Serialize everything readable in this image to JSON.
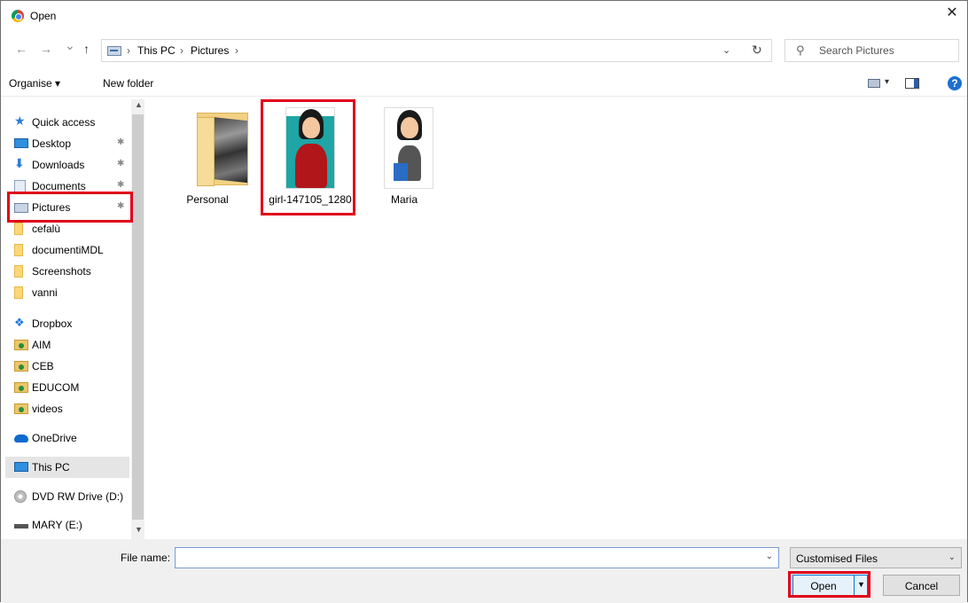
{
  "window": {
    "title": "Open",
    "close_glyph": "✕",
    "app_icon": "chrome-icon"
  },
  "nav": {
    "back_glyph": "←",
    "forward_glyph": "→",
    "recent_glyph": "⌄",
    "up_glyph": "↑",
    "breadcrumbs": [
      "This PC",
      "Pictures"
    ],
    "separator": "›",
    "dropdown_glyph": "⌄",
    "refresh_glyph": "↻",
    "search_placeholder": "Search Pictures",
    "search_glyph": "⚲"
  },
  "toolbar": {
    "organise_label": "Organise ▾",
    "new_folder_label": "New folder",
    "view_caret": "▾",
    "help_glyph": "?"
  },
  "sidebar": {
    "items": [
      {
        "label": "Quick access",
        "icon": "star-icon",
        "pinned": false
      },
      {
        "label": "Desktop",
        "icon": "desktop-icon",
        "pinned": true
      },
      {
        "label": "Downloads",
        "icon": "download-icon",
        "pinned": true
      },
      {
        "label": "Documents",
        "icon": "documents-icon",
        "pinned": true
      },
      {
        "label": "Pictures",
        "icon": "pictures-icon",
        "pinned": true
      },
      {
        "label": "cefalù",
        "icon": "folder-icon",
        "pinned": false
      },
      {
        "label": "documentiMDL",
        "icon": "folder-icon",
        "pinned": false
      },
      {
        "label": "Screenshots",
        "icon": "folder-icon",
        "pinned": false
      },
      {
        "label": "vanni",
        "icon": "folder-icon",
        "pinned": false
      },
      {
        "label": "Dropbox",
        "icon": "dropbox-icon",
        "pinned": false
      },
      {
        "label": "AIM",
        "icon": "shared-folder-icon",
        "pinned": false
      },
      {
        "label": "CEB",
        "icon": "shared-folder-icon",
        "pinned": false
      },
      {
        "label": "EDUCOM",
        "icon": "shared-folder-icon",
        "pinned": false
      },
      {
        "label": "videos",
        "icon": "shared-folder-icon",
        "pinned": false
      },
      {
        "label": "OneDrive",
        "icon": "onedrive-icon",
        "pinned": false
      },
      {
        "label": "This PC",
        "icon": "this-pc-icon",
        "pinned": false
      },
      {
        "label": "DVD RW Drive (D:)",
        "icon": "dvd-drive-icon",
        "pinned": false
      },
      {
        "label": "MARY (E:)",
        "icon": "usb-drive-icon",
        "pinned": false
      }
    ],
    "pin_glyph": "📌",
    "scroll_up_glyph": "▲",
    "scroll_down_glyph": "▼",
    "selected": "This PC"
  },
  "files": [
    {
      "name": "Personal",
      "type": "folder"
    },
    {
      "name": "girl-147105_1280",
      "type": "image"
    },
    {
      "name": "Maria",
      "type": "image"
    }
  ],
  "bottom": {
    "file_name_label": "File name:",
    "file_name_value": "",
    "filter_value": "Customised Files",
    "caret": "⌄",
    "open_label": "Open",
    "open_split_caret": "▼",
    "cancel_label": "Cancel"
  },
  "highlights": {
    "color": "#e0001a"
  }
}
